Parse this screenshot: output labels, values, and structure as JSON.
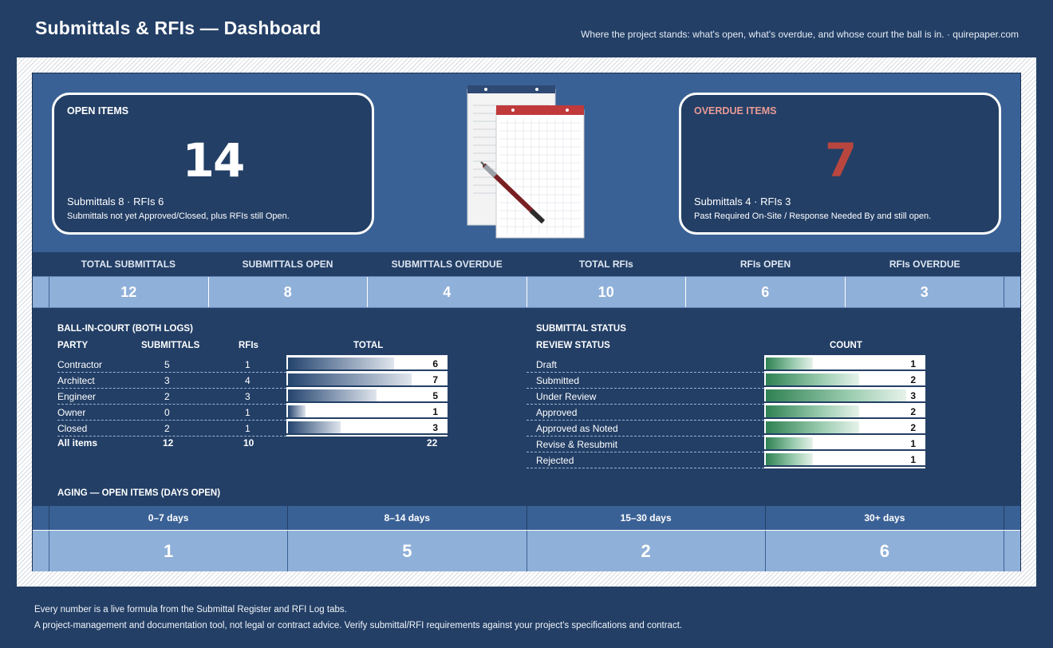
{
  "header": {
    "title": "Submittals & RFIs — Dashboard",
    "tagline": "Where the project stands: what's open, what's overdue, and whose court the ball is in. · quirepaper.com"
  },
  "open_items": {
    "label": "OPEN ITEMS",
    "value": "14",
    "breakdown": "Submittals 8 · RFIs 6",
    "note": "Submittals not yet Approved/Closed, plus RFIs still Open."
  },
  "overdue_items": {
    "label": "OVERDUE ITEMS",
    "value": "7",
    "breakdown": "Submittals 4 · RFIs 3",
    "note": "Past Required On-Site / Response Needed By and still open."
  },
  "stats": [
    {
      "label": "TOTAL SUBMITTALS",
      "value": "12"
    },
    {
      "label": "SUBMITTALS OPEN",
      "value": "8"
    },
    {
      "label": "SUBMITTALS OVERDUE",
      "value": "4"
    },
    {
      "label": "TOTAL RFIs",
      "value": "10"
    },
    {
      "label": "RFIs OPEN",
      "value": "6"
    },
    {
      "label": "RFIs OVERDUE",
      "value": "3"
    }
  ],
  "ball_in_court": {
    "title": "BALL-IN-COURT (BOTH LOGS)",
    "headers": {
      "party": "PARTY",
      "submittals": "SUBMITTALS",
      "rfis": "RFIs",
      "total": "TOTAL"
    },
    "rows": [
      {
        "party": "Contractor",
        "submittals": "5",
        "rfis": "1",
        "total": 6
      },
      {
        "party": "Architect",
        "submittals": "3",
        "rfis": "4",
        "total": 7
      },
      {
        "party": "Engineer",
        "submittals": "2",
        "rfis": "3",
        "total": 5
      },
      {
        "party": "Owner",
        "submittals": "0",
        "rfis": "1",
        "total": 1
      },
      {
        "party": "Closed",
        "submittals": "2",
        "rfis": "1",
        "total": 3
      }
    ],
    "totals": {
      "party": "All items",
      "submittals": "12",
      "rfis": "10",
      "total": "22"
    },
    "bar_max": 7,
    "bar_color": "#24446e"
  },
  "submittal_status": {
    "title": "SUBMITTAL STATUS",
    "headers": {
      "status": "REVIEW STATUS",
      "count": "COUNT"
    },
    "rows": [
      {
        "status": "Draft",
        "count": 1
      },
      {
        "status": "Submitted",
        "count": 2
      },
      {
        "status": "Under Review",
        "count": 3
      },
      {
        "status": "Approved",
        "count": 2
      },
      {
        "status": "Approved as Noted",
        "count": 2
      },
      {
        "status": "Revise & Resubmit",
        "count": 1
      },
      {
        "status": "Rejected",
        "count": 1
      }
    ],
    "bar_max": 3,
    "bar_color": "#2f8153"
  },
  "aging": {
    "title": "AGING — OPEN ITEMS (DAYS OPEN)",
    "buckets": [
      {
        "label": "0–7 days",
        "value": "1"
      },
      {
        "label": "8–14 days",
        "value": "5"
      },
      {
        "label": "15–30 days",
        "value": "2"
      },
      {
        "label": "30+ days",
        "value": "6"
      }
    ]
  },
  "footer": {
    "line1": "Every number is a live formula from the Submittal Register and RFI Log tabs.",
    "line2": "A project-management and documentation tool, not legal or contract advice. Verify submittal/RFI requirements against your project's specifications and contract."
  },
  "colors": {
    "background": "#233f66",
    "band": "#3a6195",
    "value_cells": "#8fb0d8",
    "overdue_value": "#b8463f",
    "overdue_label": "#e89a94"
  },
  "icons": {
    "illustration": "notepads-with-pen-icon"
  }
}
